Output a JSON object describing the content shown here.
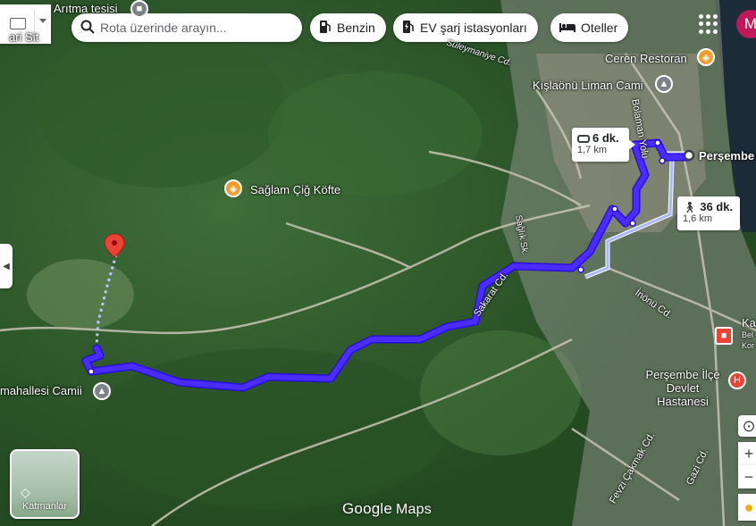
{
  "search": {
    "placeholder": "Rota üzerinde arayın..."
  },
  "filters": [
    {
      "label": "Benzin",
      "icon": "gas-station-icon"
    },
    {
      "label": "EV şarj istasyonları",
      "icon": "ev-charger-icon"
    },
    {
      "label": "Oteller",
      "icon": "bed-icon"
    }
  ],
  "account": {
    "initial": "M"
  },
  "route": {
    "drive": {
      "time": "6 dk.",
      "distance": "1,7 km"
    },
    "walk": {
      "time": "36 dk.",
      "distance": "1,6 km"
    },
    "start_label": "Perşembe",
    "colors": {
      "route": "#3a1cff",
      "walk_alt": "#a9b7ff",
      "destination": "#ea4335"
    }
  },
  "places": [
    {
      "name": "Arıtma tesisi",
      "type": "landmark"
    },
    {
      "name": "Süleymaniye Cd.",
      "type": "street"
    },
    {
      "name": "Ceren Restoran",
      "type": "restaurant"
    },
    {
      "name": "Kışlaönü Liman Cami",
      "type": "mosque"
    },
    {
      "name": "Bolaman Yolu",
      "type": "street"
    },
    {
      "name": "Sağlam Çiğ Köfte",
      "type": "restaurant"
    },
    {
      "name": "Sağlık Sk.",
      "type": "street"
    },
    {
      "name": "Sakarat Cd.",
      "type": "street"
    },
    {
      "name": "İnönü Cd.",
      "type": "street"
    },
    {
      "name": "mahallesi Camii",
      "type": "mosque"
    },
    {
      "name": "Perşembe İlçe Devlet Hastanesi",
      "type": "hospital"
    },
    {
      "name": "Fevzi Çakmak Cd.",
      "type": "street"
    },
    {
      "name": "Gazi Cd.",
      "type": "street"
    },
    {
      "name": "Ka",
      "type": "partial"
    },
    {
      "name": "Bel",
      "type": "partial"
    },
    {
      "name": "Kor",
      "type": "partial"
    },
    {
      "name": "ari Sit",
      "type": "partial"
    }
  ],
  "layers": {
    "label": "Katmanlar"
  },
  "brand": {
    "google": "Google",
    "maps": "Maps"
  }
}
